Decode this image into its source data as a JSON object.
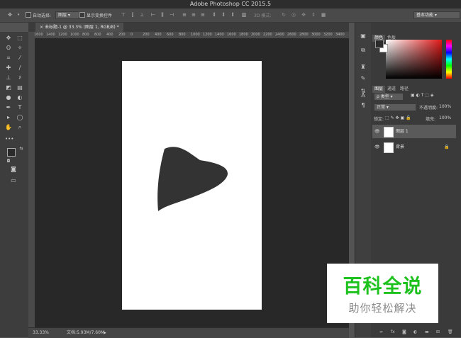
{
  "window": {
    "title": "Adobe Photoshop CC 2015.5"
  },
  "options_bar": {
    "auto_select_label": "自动选择:",
    "auto_select_value": "图层",
    "show_transform_label": "显示变换控件",
    "mode_3d_label": "3D 模式:",
    "workspace": "基本功能"
  },
  "document": {
    "tab_label": "未标题-1 @ 33.3% (图层 1, RGB/8) *",
    "ruler_ticks": [
      "1600",
      "1400",
      "1200",
      "1000",
      "800",
      "600",
      "400",
      "200",
      "0",
      "200",
      "400",
      "600",
      "800",
      "1000",
      "1200",
      "1400",
      "1600",
      "1800",
      "2000",
      "2200",
      "2400",
      "2600",
      "2800",
      "3000",
      "3200",
      "3400"
    ],
    "shape_color": "#333333"
  },
  "status": {
    "zoom": "33.33%",
    "doc_size": "文档:5.93M/7.60M"
  },
  "color_panel": {
    "tabs": [
      "颜色",
      "色板"
    ],
    "foreground": "#2b2b2b",
    "background": "#ffffff"
  },
  "layers_panel": {
    "tabs": [
      "图层",
      "通道",
      "路径"
    ],
    "filter_label": "ρ 类型",
    "blend_mode": "正常",
    "opacity_label": "不透明度:",
    "opacity_value": "100%",
    "lock_label": "锁定:",
    "fill_label": "填充:",
    "fill_value": "100%",
    "layers": [
      {
        "name": "图层 1",
        "selected": true
      },
      {
        "name": "背景",
        "selected": false
      }
    ]
  },
  "watermark": {
    "title": "百科全说",
    "subtitle": "助你轻松解决"
  },
  "icons": [
    "move-icon",
    "marquee-icon",
    "lasso-icon",
    "magic-wand-icon",
    "crop-icon",
    "eyedropper-icon",
    "healing-icon",
    "brush-icon",
    "stamp-icon",
    "history-brush-icon",
    "eraser-icon",
    "gradient-icon",
    "blur-icon",
    "dodge-icon",
    "pen-icon",
    "type-icon",
    "path-select-icon",
    "ellipse-icon",
    "hand-icon",
    "zoom-icon"
  ]
}
